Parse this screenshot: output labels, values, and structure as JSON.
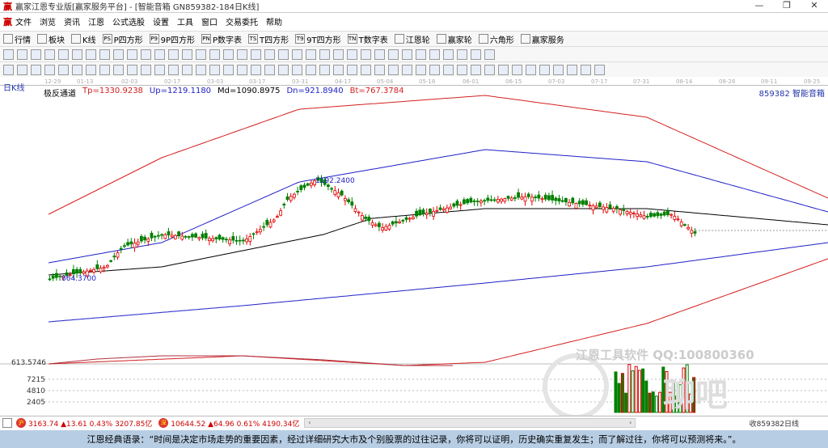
{
  "window": {
    "title": "赢家江恩专业版[赢家服务平台] - [智能音箱  GN859382-184日K线]",
    "controls": [
      "—",
      "❐",
      "✕"
    ]
  },
  "menu": [
    "文件",
    "浏览",
    "资讯",
    "江恩",
    "公式选股",
    "设置",
    "工具",
    "窗口",
    "交易委托",
    "帮助"
  ],
  "toolbar1": [
    {
      "icon": "table-icon",
      "label": "行情"
    },
    {
      "icon": "blocks-icon",
      "label": "板块"
    },
    {
      "icon": "candle-icon",
      "label": "K线"
    },
    {
      "icon": "PS",
      "label": "P四方形"
    },
    {
      "icon": "P9",
      "label": "9P四方形"
    },
    {
      "icon": "PN",
      "label": "P数字表"
    },
    {
      "icon": "TS",
      "label": "T四方形"
    },
    {
      "icon": "T9",
      "label": "9T四方形"
    },
    {
      "icon": "TN",
      "label": "T数字表"
    },
    {
      "icon": "target-icon",
      "label": "江恩轮"
    },
    {
      "icon": "wheel-icon",
      "label": "赢家轮"
    },
    {
      "icon": "hexagon-icon",
      "label": "六角形"
    },
    {
      "icon": "dollar-icon",
      "label": "赢家服务"
    }
  ],
  "date_axis": [
    "12-29",
    "01-13",
    "02-03",
    "02-17",
    "03-03",
    "03-17",
    "03-31",
    "04-17",
    "05-04",
    "05-18",
    "06-01",
    "06-15",
    "07-03",
    "07-17",
    "07-31",
    "08-14",
    "08-28",
    "09-11",
    "09-25"
  ],
  "chart": {
    "period": "日K线",
    "indicator": "极反通道",
    "tp": "Tp=1330.9238",
    "up": "Up=1219.1180",
    "md": "Md=1090.8975",
    "dn": "Dn=921.8940",
    "bt": "Bt=767.3784",
    "code": "859382 智能音箱",
    "high_label": "1192.2400",
    "low_label": "864.3700",
    "bottom_label": "613.5746",
    "volume_ticks": [
      "7215",
      "4810",
      "2405"
    ],
    "colors": {
      "tp": "#d42020",
      "up": "#2020c8",
      "md": "#000000",
      "up_candle": "#e00000",
      "down_candle": "#008000"
    }
  },
  "watermark": {
    "text": "江恩工具软件  QQ:100800360",
    "brand": "聊吧"
  },
  "status": {
    "sh_index": "3163.74 ▲13.61 0.43% 3207.85亿",
    "sz_index": "10644.52 ▲64.96 0.61% 4190.34亿",
    "sh_badge": "沪",
    "sz_badge": "深",
    "right": "收859382日线"
  },
  "quote": "江恩经典语录：“时间是决定市场走势的重要因素，经过详细研究大市及个别股票的过往记录，你将可以证明，历史确实重复发生；而了解过往，你将可以预测将来。”。"
}
